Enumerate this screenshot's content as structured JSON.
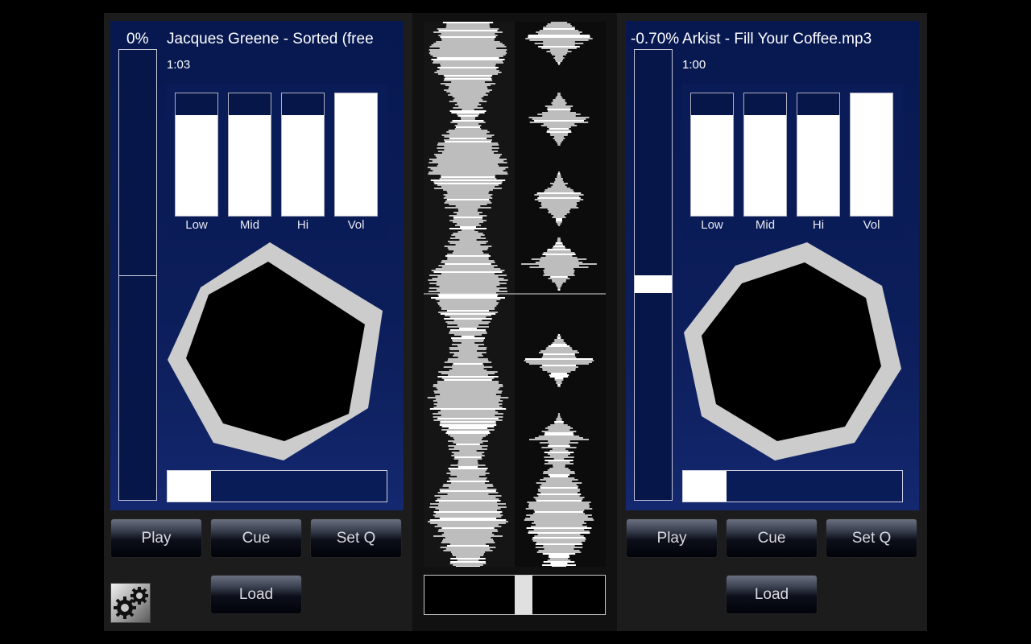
{
  "decks": {
    "left": {
      "pitch": "0%",
      "title": "Jacques Greene - Sorted (free ",
      "time": "1:03",
      "eq_labels": [
        "Low",
        "Mid",
        "Hi",
        "Vol"
      ],
      "eq_levels": [
        0.82,
        0.82,
        0.82,
        1.0
      ],
      "pitch_level": 0.5,
      "progress": 0.2,
      "buttons": {
        "play": "Play",
        "cue": "Cue",
        "setq": "Set Q",
        "load": "Load"
      }
    },
    "right": {
      "pitch": "-0.70%",
      "title": "Arkist - Fill Your Coffee.mp3",
      "time": "1:00",
      "eq_labels": [
        "Low",
        "Mid",
        "Hi",
        "Vol"
      ],
      "eq_levels": [
        0.82,
        0.82,
        0.82,
        1.0
      ],
      "pitch_level": 0.52,
      "progress": 0.2,
      "buttons": {
        "play": "Play",
        "cue": "Cue",
        "setq": "Set Q",
        "load": "Load"
      }
    }
  },
  "crossfader": {
    "position": 0.55
  },
  "colors": {
    "panel": "#071850",
    "accent": "#ffffff",
    "jog_ring": "#cccccc"
  },
  "icons": {
    "settings": "gears-icon"
  }
}
